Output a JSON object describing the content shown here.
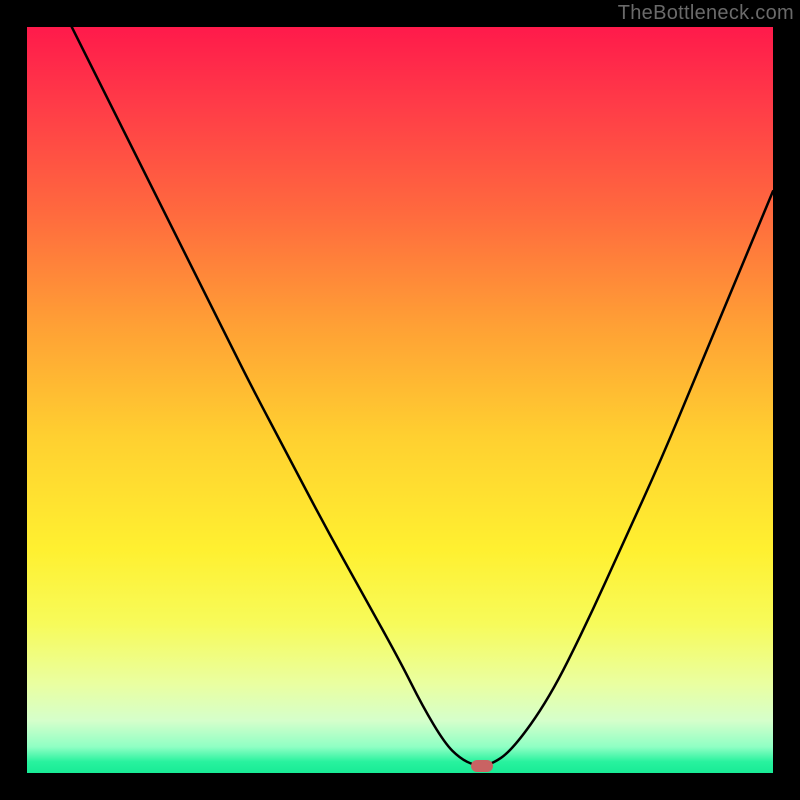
{
  "watermark": "TheBottleneck.com",
  "colors": {
    "frame": "#000000",
    "curve": "#000000",
    "marker": "#c96363",
    "gradient_stops": [
      {
        "offset": 0.0,
        "color": "#ff1a4b"
      },
      {
        "offset": 0.1,
        "color": "#ff3a48"
      },
      {
        "offset": 0.25,
        "color": "#ff6a3e"
      },
      {
        "offset": 0.4,
        "color": "#ffa035"
      },
      {
        "offset": 0.55,
        "color": "#ffd030"
      },
      {
        "offset": 0.7,
        "color": "#fff030"
      },
      {
        "offset": 0.8,
        "color": "#f7fb5a"
      },
      {
        "offset": 0.88,
        "color": "#eaffa0"
      },
      {
        "offset": 0.93,
        "color": "#d5ffcb"
      },
      {
        "offset": 0.965,
        "color": "#8fffc4"
      },
      {
        "offset": 0.985,
        "color": "#28f29e"
      },
      {
        "offset": 1.0,
        "color": "#18eb96"
      }
    ]
  },
  "chart_data": {
    "type": "line",
    "title": "",
    "xlabel": "",
    "ylabel": "",
    "xlim": [
      0,
      100
    ],
    "ylim": [
      0,
      100
    ],
    "grid": false,
    "legend": false,
    "series": [
      {
        "name": "bottleneck-curve",
        "x": [
          6,
          10,
          15,
          20,
          25,
          27,
          30,
          35,
          40,
          45,
          50,
          53,
          56,
          58,
          60,
          62,
          65,
          70,
          75,
          80,
          85,
          90,
          95,
          100
        ],
        "y": [
          100,
          92,
          82,
          72,
          62,
          58,
          52,
          42.5,
          33,
          24,
          15,
          9,
          4,
          2,
          1,
          1,
          3,
          10,
          20,
          31,
          42,
          54,
          66,
          78
        ]
      }
    ],
    "marker": {
      "x": 61,
      "y": 1
    },
    "notes": "Background is a vertical red→yellow→green gradient. Curve is black V-shape with minimum near x≈61. Values estimated from pixels."
  }
}
